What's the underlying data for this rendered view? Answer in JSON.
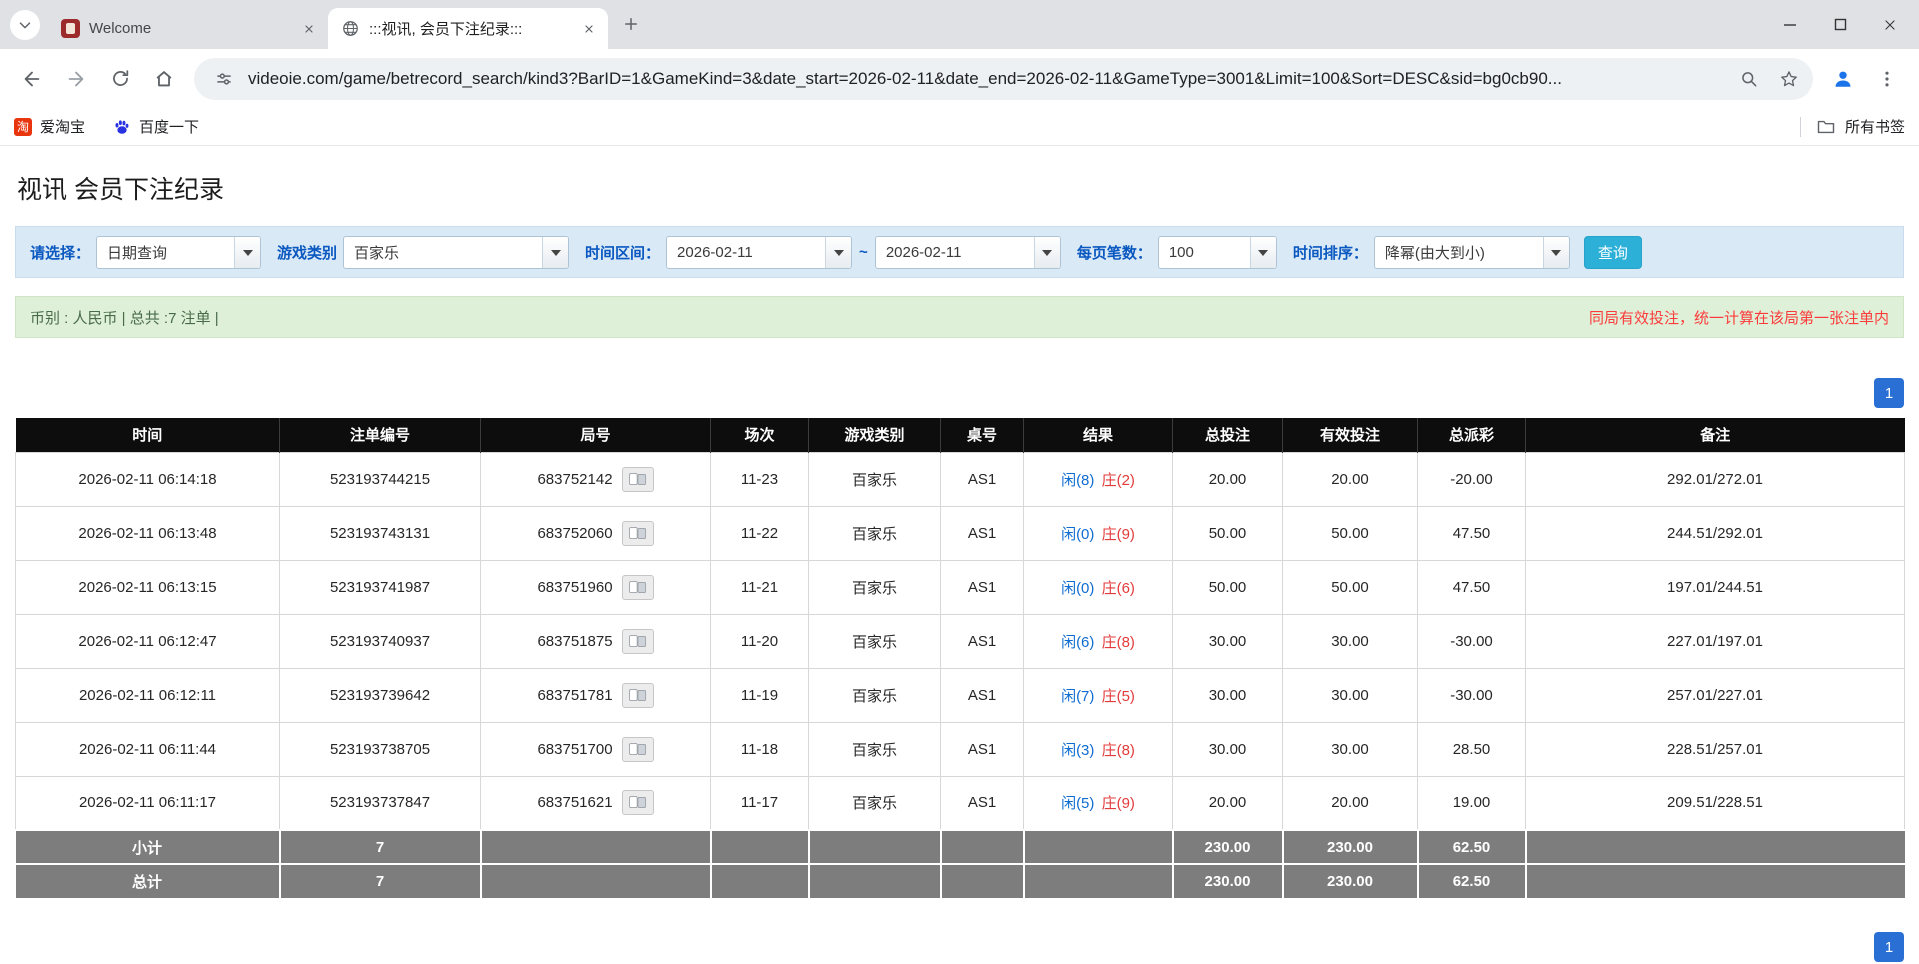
{
  "colors": {
    "accent_blue": "#0e6cd0",
    "negative_red": "#e33b3b",
    "notice_red": "#fb3b3b",
    "filter_bg": "#d9e9f6",
    "summary_bg": "#dff0d8",
    "search_button_bg": "#2cb0d8",
    "pager_bg": "#2a6fd4",
    "table_header_bg": "#0d0d0d",
    "table_footer_bg": "#7d7d7d"
  },
  "browser": {
    "tabs": [
      {
        "title": "Welcome"
      },
      {
        "title": ":::视讯, 会员下注纪录:::"
      }
    ],
    "url": "videoie.com/game/betrecord_search/kind3?BarID=1&GameKind=3&date_start=2026-02-11&date_end=2026-02-11&GameType=3001&Limit=100&Sort=DESC&sid=bg0cb90...",
    "bookmarks": {
      "taobao_icon_char": "淘",
      "items": [
        {
          "label": "爱淘宝"
        },
        {
          "label": "百度一下"
        }
      ],
      "all_bookmarks": "所有书签"
    }
  },
  "page": {
    "title": "视讯 会员下注纪录",
    "filters": {
      "select_label": "请选择：",
      "select_value": "日期查询",
      "game_label": "游戏类别",
      "game_value": "百家乐",
      "date_label": "时间区间：",
      "date_start": "2026-02-11",
      "date_separator": "~",
      "date_end": "2026-02-11",
      "per_page_label": "每页笔数：",
      "per_page_value": "100",
      "sort_label": "时间排序：",
      "sort_value": "降幂(由大到小)",
      "search_button": "查询"
    },
    "summary": {
      "left": "币别 : 人民币 | 总共 :7 注单 |",
      "right": "同局有效投注，统一计算在该局第一张注单内"
    },
    "pagination": {
      "current": "1"
    },
    "table": {
      "headers": [
        "时间",
        "注单编号",
        "局号",
        "场次",
        "游戏类别",
        "桌号",
        "结果",
        "总投注",
        "有效投注",
        "总派彩",
        "备注"
      ],
      "rows": [
        {
          "time": "2026-02-11 06:14:18",
          "bet_id": "523193744215",
          "round": "683752142",
          "session": "11-23",
          "game": "百家乐",
          "table_no": "AS1",
          "player": "闲(8)",
          "banker": "庄(2)",
          "total_bet": "20.00",
          "valid_bet": "20.00",
          "payout": "-20.00",
          "note": "292.01/272.01"
        },
        {
          "time": "2026-02-11 06:13:48",
          "bet_id": "523193743131",
          "round": "683752060",
          "session": "11-22",
          "game": "百家乐",
          "table_no": "AS1",
          "player": "闲(0)",
          "banker": "庄(9)",
          "total_bet": "50.00",
          "valid_bet": "50.00",
          "payout": "47.50",
          "note": "244.51/292.01"
        },
        {
          "time": "2026-02-11 06:13:15",
          "bet_id": "523193741987",
          "round": "683751960",
          "session": "11-21",
          "game": "百家乐",
          "table_no": "AS1",
          "player": "闲(0)",
          "banker": "庄(6)",
          "total_bet": "50.00",
          "valid_bet": "50.00",
          "payout": "47.50",
          "note": "197.01/244.51"
        },
        {
          "time": "2026-02-11 06:12:47",
          "bet_id": "523193740937",
          "round": "683751875",
          "session": "11-20",
          "game": "百家乐",
          "table_no": "AS1",
          "player": "闲(6)",
          "banker": "庄(8)",
          "total_bet": "30.00",
          "valid_bet": "30.00",
          "payout": "-30.00",
          "note": "227.01/197.01"
        },
        {
          "time": "2026-02-11 06:12:11",
          "bet_id": "523193739642",
          "round": "683751781",
          "session": "11-19",
          "game": "百家乐",
          "table_no": "AS1",
          "player": "闲(7)",
          "banker": "庄(5)",
          "total_bet": "30.00",
          "valid_bet": "30.00",
          "payout": "-30.00",
          "note": "257.01/227.01"
        },
        {
          "time": "2026-02-11 06:11:44",
          "bet_id": "523193738705",
          "round": "683751700",
          "session": "11-18",
          "game": "百家乐",
          "table_no": "AS1",
          "player": "闲(3)",
          "banker": "庄(8)",
          "total_bet": "30.00",
          "valid_bet": "30.00",
          "payout": "28.50",
          "note": "228.51/257.01"
        },
        {
          "time": "2026-02-11 06:11:17",
          "bet_id": "523193737847",
          "round": "683751621",
          "session": "11-17",
          "game": "百家乐",
          "table_no": "AS1",
          "player": "闲(5)",
          "banker": "庄(9)",
          "total_bet": "20.00",
          "valid_bet": "20.00",
          "payout": "19.00",
          "note": "209.51/228.51"
        }
      ],
      "subtotal": {
        "label": "小计",
        "count": "7",
        "total_bet": "230.00",
        "valid_bet": "230.00",
        "payout": "62.50"
      },
      "total": {
        "label": "总计",
        "count": "7",
        "total_bet": "230.00",
        "valid_bet": "230.00",
        "payout": "62.50"
      }
    }
  }
}
